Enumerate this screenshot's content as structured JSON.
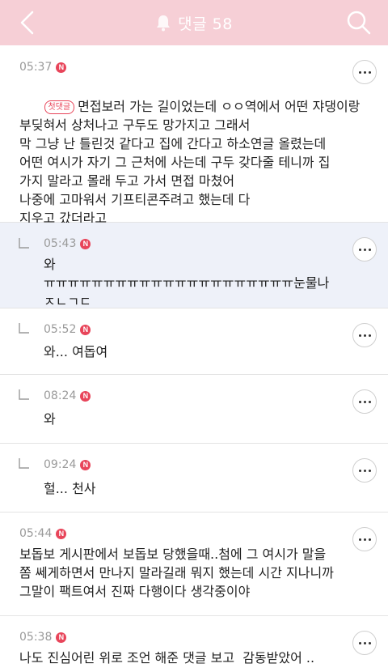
{
  "header": {
    "title": "댓글 58",
    "icons": {
      "back": "chevron-left-icon",
      "bell": "bell-icon",
      "search": "search-icon"
    },
    "bg_color": "#f6cfd6"
  },
  "badge_new": "N",
  "comments": [
    {
      "time": "05:37",
      "first_label": "첫댓글",
      "text": "면접보러 가는 길이었는데 ㅇㅇ역에서 어떤 쟈댕이랑\n부딪혀서 상처나고 구두도 망가지고 그래서\n막 그냥 난 틀린것 같다고 집에 간다고 하소연글 올렸는데\n어떤 여시가 자기 그 근처에 사는데 구두 갖다줄 테니까 집\n가지 말라고 몰래 두고 가서 면접 마쳤어\n나중에 고마워서 기프티콘주려고 했는데 다\n지우고 갔더라고"
    },
    {
      "time": "05:43",
      "text": "와 ㅠㅠㅠㅠㅠㅠㅠㅠㅠㅠㅠㅠㅠㅠㅠㅠㅠㅠㅠㅠㅠ눈물나\nㅈㄴㄱㄷ"
    },
    {
      "time": "05:52",
      "text": "와... 여돕여"
    },
    {
      "time": "08:24",
      "text": "와"
    },
    {
      "time": "09:24",
      "text": "헐... 천사"
    },
    {
      "time": "05:44",
      "text": "보돕보 게시판에서 보돕보 당했을때..첨에 그 여시가 말을\n쫌 쎄게하면서 만나지 말라길래 뭐지 했는데 시간 지나니까\n그말이 팩트여서 진짜 다행이다 생각중이야"
    },
    {
      "time": "05:38",
      "text": "나도 진심어린 위로 조언 해준 댓글 보고  감동받았어 .."
    }
  ]
}
